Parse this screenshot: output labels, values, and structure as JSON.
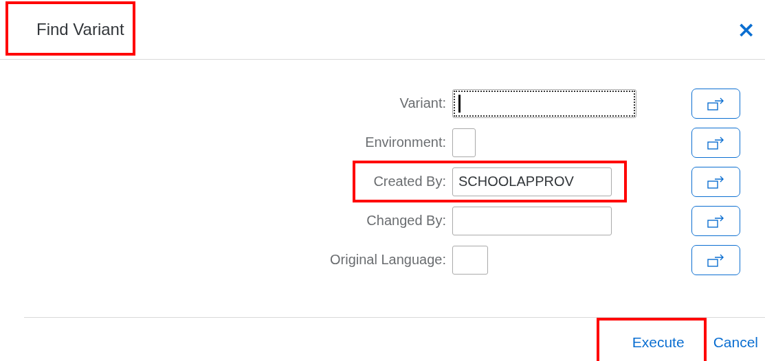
{
  "dialog": {
    "title": "Find Variant",
    "title_highlighted": true,
    "close_icon": "×"
  },
  "fields": [
    {
      "label": "Variant:",
      "kind": "long",
      "focused": true,
      "highlighted": false
    },
    {
      "label": "Environment:",
      "kind": "tiny",
      "focused": false,
      "highlighted": false
    },
    {
      "label": "Created By:",
      "value": "SCHOOLAPPROV",
      "kind": "medium",
      "focused": false,
      "highlighted": true
    },
    {
      "label": "Changed By:",
      "kind": "medium",
      "focused": false,
      "highlighted": false
    },
    {
      "label": "Original Language:",
      "kind": "short",
      "focused": false,
      "highlighted": false
    }
  ],
  "buttons": [
    {
      "label": "Execute",
      "highlighted": true
    },
    {
      "label": "Cancel",
      "highlighted": false
    }
  ]
}
